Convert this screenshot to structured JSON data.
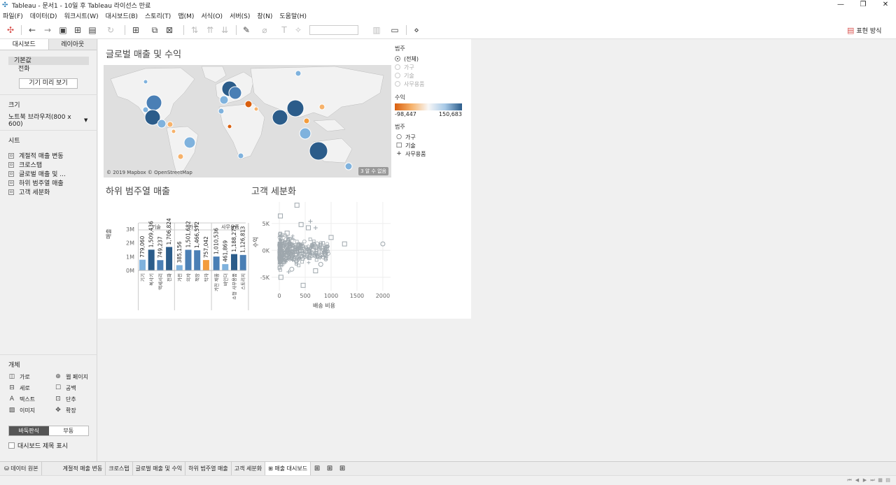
{
  "window": {
    "title": "Tableau - 문서1 - 10일 후 Tableau 라이선스 만료",
    "controls": [
      "—",
      "❐",
      "✕"
    ]
  },
  "menu": [
    "파일(F)",
    "데이터(D)",
    "워크시트(W)",
    "대시보드(B)",
    "스토리(T)",
    "맵(M)",
    "서식(O)",
    "서버(S)",
    "창(N)",
    "도움말(H)"
  ],
  "toolbar": {
    "show_me": "표현 방식"
  },
  "left": {
    "tabs": [
      "대시보드",
      "레이아웃"
    ],
    "device": {
      "default": "기본값",
      "phone": "전화",
      "preview_button": "기기 미리 보기"
    },
    "size": {
      "title": "크기",
      "value": "노트북 브라우저(800 x 600)"
    },
    "sheets": {
      "title": "시트",
      "items": [
        "계절적 매출 변동",
        "크로스탭",
        "글로벌 매출 및 ...",
        "하위 범주열 매출",
        "고객 세분화"
      ]
    },
    "objects": {
      "title": "개체",
      "items": [
        {
          "icon": "horizontal-icon",
          "label": "가로"
        },
        {
          "icon": "webpage-icon",
          "label": "웹 페이지"
        },
        {
          "icon": "vertical-icon",
          "label": "세로"
        },
        {
          "icon": "blank-icon",
          "label": "공백"
        },
        {
          "icon": "text-icon",
          "label": "텍스트"
        },
        {
          "icon": "button-icon",
          "label": "단추"
        },
        {
          "icon": "image-icon",
          "label": "이미지"
        },
        {
          "icon": "extension-icon",
          "label": "확장"
        }
      ]
    },
    "layout_toggle": [
      "바둑판식",
      "부동"
    ],
    "show_title": "대시보드 제목 표시"
  },
  "dashboard": {
    "map_title": "글로벌 매출 및 수익",
    "map_credit": "© 2019 Mapbox © OpenStreetMap",
    "unknown_badge": "3 알 수 없음",
    "bar_title": "하위 범주열 매출",
    "scatter_title": "고객 세분화"
  },
  "legend": {
    "category_title": "범주",
    "category_options": [
      "(전체)",
      "가구",
      "기술",
      "사무용품"
    ],
    "profit_title": "수익",
    "profit_min": "-98,447",
    "profit_max": "150,683",
    "shape_title": "범주",
    "shape_items": [
      "가구",
      "기술",
      "사무용품"
    ]
  },
  "colors": {
    "dark_blue": "#2b5c8a",
    "mid_blue": "#4a7fb5",
    "light_blue": "#7fb2dd",
    "orange": "#f39c3c",
    "dark_orange": "#d95f0e",
    "pale_orange": "#f6b26b"
  },
  "chart_data": [
    {
      "type": "bar",
      "title": "하위 범주열 매출",
      "ylabel": "매출",
      "yticks": [
        "3M",
        "2M",
        "1M",
        "0M"
      ],
      "ylim": [
        0,
        3200000
      ],
      "groups": [
        "기술",
        "가구",
        "사무용품"
      ],
      "categories": [
        "기기",
        "복사기",
        "액세서리",
        "전화",
        "가전",
        "의자",
        "책장",
        "탁자",
        "가전 제품",
        "바인더",
        "소형 사무용품",
        "스토리지"
      ],
      "group_of": [
        0,
        0,
        0,
        0,
        1,
        1,
        1,
        1,
        2,
        2,
        2,
        2
      ],
      "values": [
        779060,
        1509436,
        749237,
        1706824,
        385156,
        1501682,
        1466572,
        757042,
        1010536,
        461869,
        1188275,
        1126813
      ],
      "labels": [
        "779,060",
        "1,509,436",
        "749,237",
        "1,706,824",
        "385,156",
        "1,501,682",
        "1,466,572",
        "757,042",
        "1,010,536",
        "461,869",
        "1,188,275",
        "1,126,813"
      ],
      "color_key": [
        "light_blue",
        "dark_blue",
        "mid_blue",
        "dark_blue",
        "light_blue",
        "mid_blue",
        "mid_blue",
        "orange",
        "mid_blue",
        "light_blue",
        "dark_blue",
        "mid_blue"
      ]
    },
    {
      "type": "scatter",
      "title": "고객 세분화",
      "xlabel": "배송 비용",
      "ylabel": "수익",
      "xticks": [
        "0",
        "500",
        "1000",
        "1500",
        "2000"
      ],
      "yticks": [
        "5K",
        "0K",
        "-5K"
      ],
      "xlim": [
        -150,
        2150
      ],
      "ylim": [
        -7500,
        9000
      ],
      "outliers": [
        {
          "x": 340,
          "y": 8400,
          "shape": "square"
        },
        {
          "x": 600,
          "y": 5400,
          "shape": "plus"
        },
        {
          "x": 700,
          "y": 4200,
          "shape": "plus"
        },
        {
          "x": 420,
          "y": 4800,
          "shape": "square"
        },
        {
          "x": 560,
          "y": 4200,
          "shape": "square"
        },
        {
          "x": 1000,
          "y": 2400,
          "shape": "square"
        },
        {
          "x": 1260,
          "y": 1200,
          "shape": "square"
        },
        {
          "x": 2000,
          "y": 1200,
          "shape": "circle"
        },
        {
          "x": 460,
          "y": -6500,
          "shape": "square"
        },
        {
          "x": 30,
          "y": -5000,
          "shape": "square"
        },
        {
          "x": 180,
          "y": -4000,
          "shape": "plus"
        },
        {
          "x": 700,
          "y": -3800,
          "shape": "square"
        },
        {
          "x": 800,
          "y": -2600,
          "shape": "circle"
        },
        {
          "x": 240,
          "y": -3500,
          "shape": "circle"
        },
        {
          "x": 20,
          "y": 6400,
          "shape": "square"
        },
        {
          "x": 150,
          "y": 3200,
          "shape": "square"
        }
      ]
    }
  ],
  "tabs": [
    "데이터 원본",
    "계절적 매출 변동",
    "크로스탭",
    "글로벌 매출 및 수익",
    "하위 범주열 매출",
    "고객 세분화",
    "매출 대시보드"
  ]
}
